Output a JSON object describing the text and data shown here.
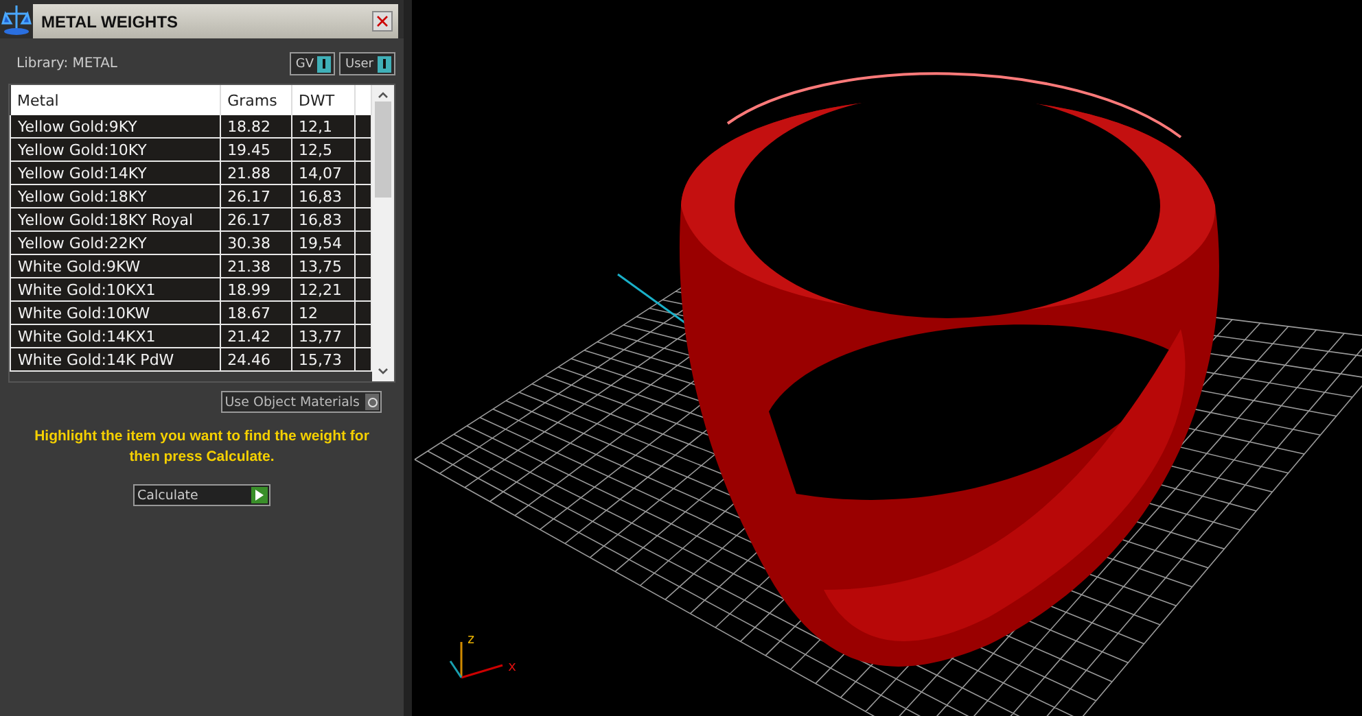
{
  "window": {
    "title": "METAL WEIGHTS"
  },
  "library": {
    "label": "Library: METAL"
  },
  "toggles": [
    {
      "label": "GV",
      "on": true
    },
    {
      "label": "User",
      "on": true
    }
  ],
  "table": {
    "columns": [
      "Metal",
      "Grams",
      "DWT"
    ],
    "rows": [
      [
        "Yellow Gold:9KY",
        "18.82",
        "12,1"
      ],
      [
        "Yellow Gold:10KY",
        "19.45",
        "12,5"
      ],
      [
        "Yellow Gold:14KY",
        "21.88",
        "14,07"
      ],
      [
        "Yellow Gold:18KY",
        "26.17",
        "16,83"
      ],
      [
        "Yellow Gold:18KY Royal",
        "26.17",
        "16,83"
      ],
      [
        "Yellow Gold:22KY",
        "30.38",
        "19,54"
      ],
      [
        "White Gold:9KW",
        "21.38",
        "13,75"
      ],
      [
        "White Gold:10KX1",
        "18.99",
        "12,21"
      ],
      [
        "White Gold:10KW",
        "18.67",
        "12"
      ],
      [
        "White Gold:14KX1",
        "21.42",
        "13,77"
      ],
      [
        "White Gold:14K PdW",
        "24.46",
        "15,73"
      ]
    ]
  },
  "use_object_materials": {
    "label": "Use Object Materials",
    "on": false
  },
  "hint": "Highlight the item you want to find the weight for then press Calculate.",
  "calculate_button": {
    "label": "Calculate"
  },
  "viewport": {
    "axes": [
      {
        "label": "z"
      },
      {
        "label": "x"
      }
    ]
  }
}
